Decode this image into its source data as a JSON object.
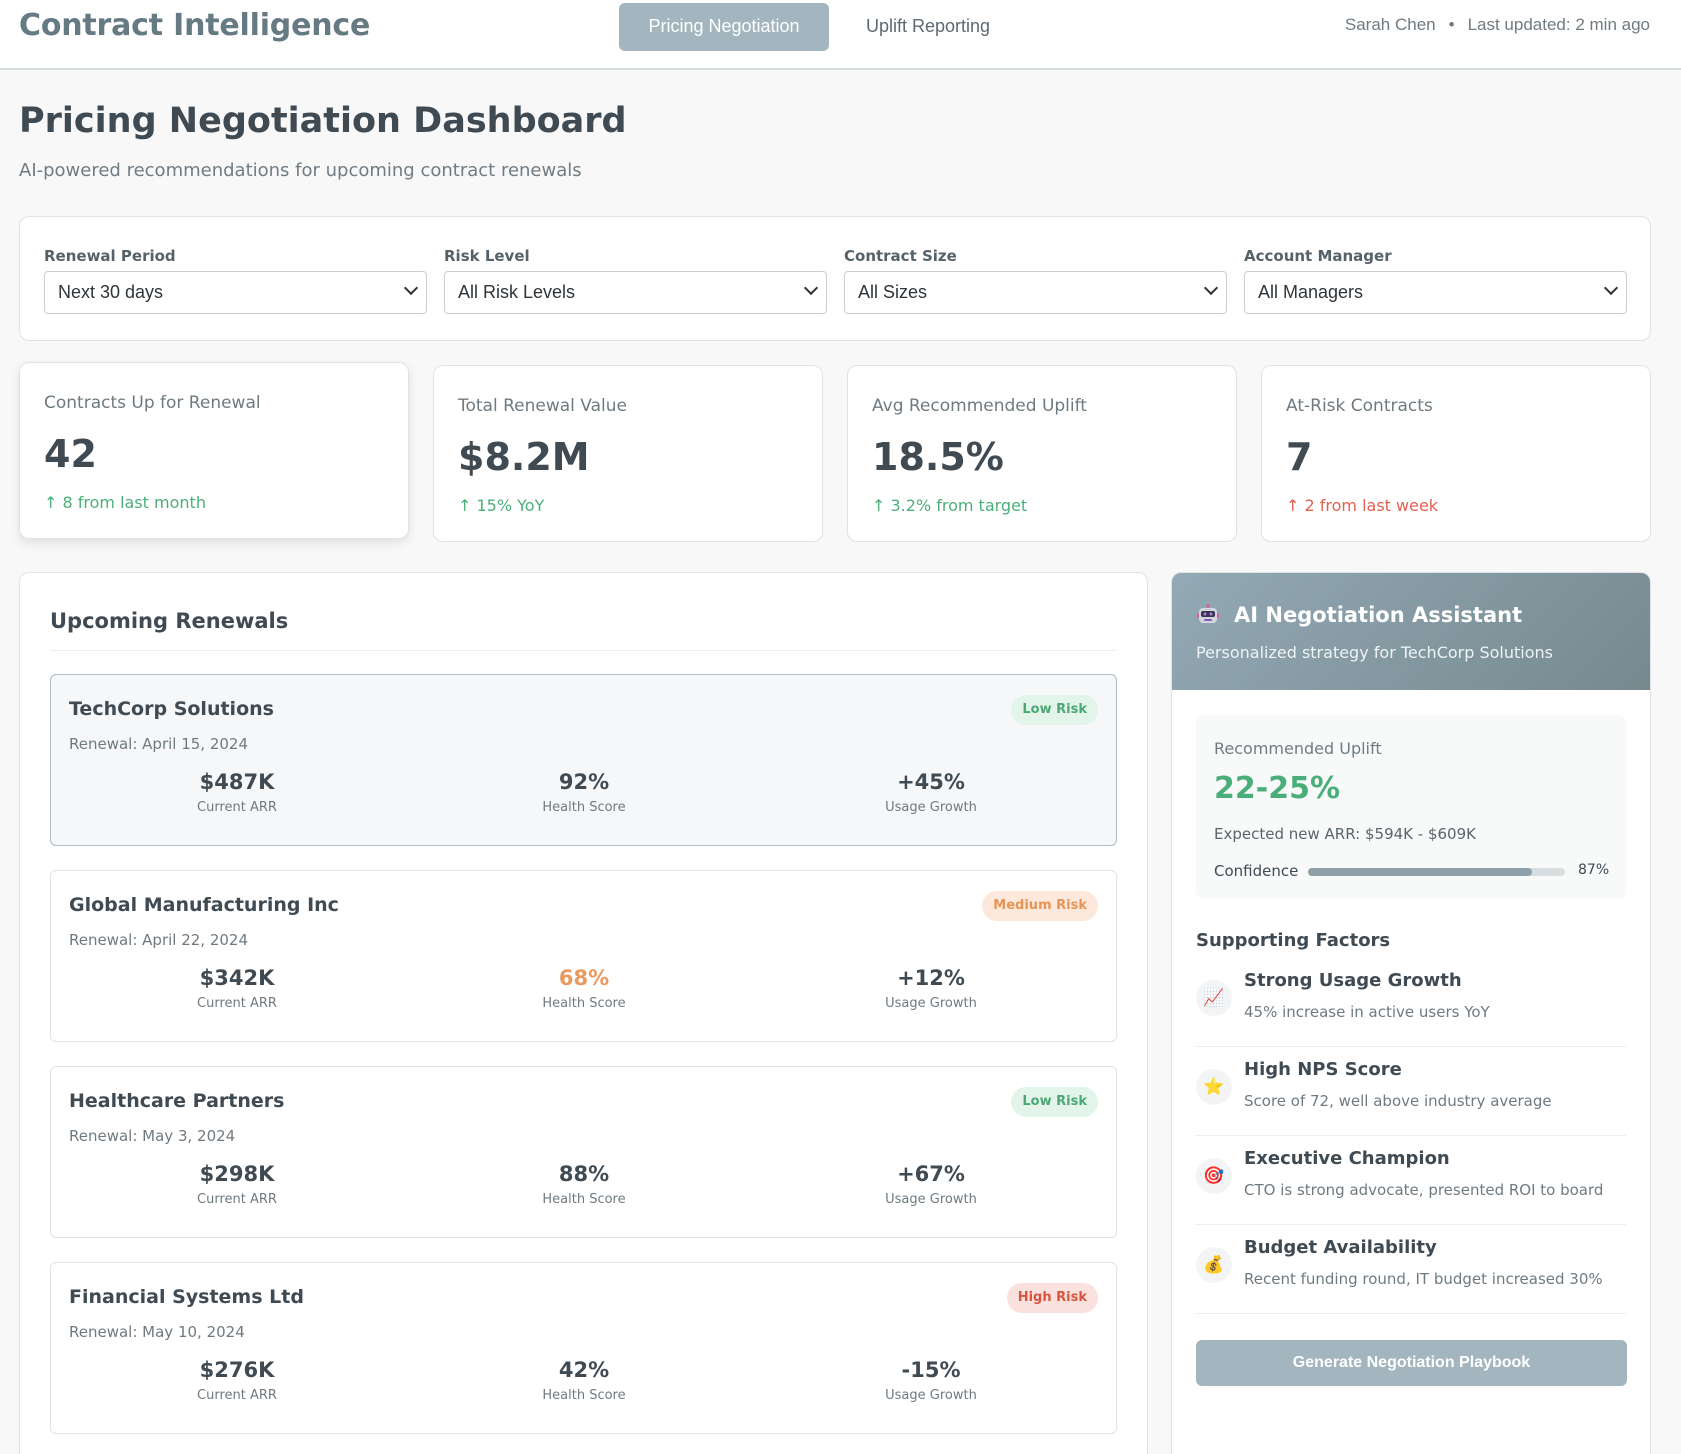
{
  "header": {
    "brand": "Contract Intelligence",
    "tabs": [
      {
        "label": "Pricing Negotiation",
        "active": true
      },
      {
        "label": "Uplift Reporting",
        "active": false
      }
    ],
    "user": "Sarah Chen",
    "separator": "•",
    "last_updated": "Last updated: 2 min ago"
  },
  "page": {
    "title": "Pricing Negotiation Dashboard",
    "subtitle": "AI-powered recommendations for upcoming contract renewals"
  },
  "filters": [
    {
      "label": "Renewal Period",
      "value": "Next 30 days"
    },
    {
      "label": "Risk Level",
      "value": "All Risk Levels"
    },
    {
      "label": "Contract Size",
      "value": "All Sizes"
    },
    {
      "label": "Account Manager",
      "value": "All Managers"
    }
  ],
  "stats": [
    {
      "label": "Contracts Up for Renewal",
      "value": "42",
      "change": "↑ 8 from last month",
      "trend": "good"
    },
    {
      "label": "Total Renewal Value",
      "value": "$8.2M",
      "change": "↑ 15% YoY",
      "trend": "good"
    },
    {
      "label": "Avg Recommended Uplift",
      "value": "18.5%",
      "change": "↑ 3.2% from target",
      "trend": "good"
    },
    {
      "label": "At-Risk Contracts",
      "value": "7",
      "change": "↑ 2 from last week",
      "trend": "bad"
    }
  ],
  "renewals": {
    "title": "Upcoming Renewals",
    "items": [
      {
        "name": "TechCorp Solutions",
        "date": "Renewal: April 15, 2024",
        "risk": "Low Risk",
        "arr": "$487K",
        "arr_label": "Current ARR",
        "health": "92%",
        "health_label": "Health Score",
        "growth": "+45%",
        "growth_label": "Usage Growth"
      },
      {
        "name": "Global Manufacturing Inc",
        "date": "Renewal: April 22, 2024",
        "risk": "Medium Risk",
        "arr": "$342K",
        "arr_label": "Current ARR",
        "health": "68%",
        "health_label": "Health Score",
        "growth": "+12%",
        "growth_label": "Usage Growth"
      },
      {
        "name": "Healthcare Partners",
        "date": "Renewal: May 3, 2024",
        "risk": "Low Risk",
        "arr": "$298K",
        "arr_label": "Current ARR",
        "health": "88%",
        "health_label": "Health Score",
        "growth": "+67%",
        "growth_label": "Usage Growth"
      },
      {
        "name": "Financial Systems Ltd",
        "date": "Renewal: May 10, 2024",
        "risk": "High Risk",
        "arr": "$276K",
        "arr_label": "Current ARR",
        "health": "42%",
        "health_label": "Health Score",
        "growth": "-15%",
        "growth_label": "Usage Growth"
      }
    ]
  },
  "assistant": {
    "icon": "robot-icon",
    "title": "AI Negotiation Assistant",
    "subtitle": "Personalized strategy for TechCorp Solutions",
    "uplift_label": "Recommended Uplift",
    "uplift_value": "22-25%",
    "expected_arr": "Expected new ARR: $594K - $609K",
    "confidence_label": "Confidence",
    "confidence_value": "87%",
    "confidence_fraction": 0.87,
    "factors_title": "Supporting Factors",
    "factors": [
      {
        "icon": "chart-increasing-icon",
        "glyph": "📈",
        "name": "Strong Usage Growth",
        "desc": "45% increase in active users YoY"
      },
      {
        "icon": "star-icon",
        "glyph": "⭐",
        "name": "High NPS Score",
        "desc": "Score of 72, well above industry average"
      },
      {
        "icon": "target-icon",
        "glyph": "🎯",
        "name": "Executive Champion",
        "desc": "CTO is strong advocate, presented ROI to board"
      },
      {
        "icon": "money-bag-icon",
        "glyph": "💰",
        "name": "Budget Availability",
        "desc": "Recent funding round, IT budget increased 30%"
      }
    ],
    "button": "Generate Negotiation Playbook"
  },
  "colors": {
    "accent": "#a3b5bf",
    "positive": "#4caf79",
    "negative": "#e2604f",
    "warning": "#e89a60"
  }
}
